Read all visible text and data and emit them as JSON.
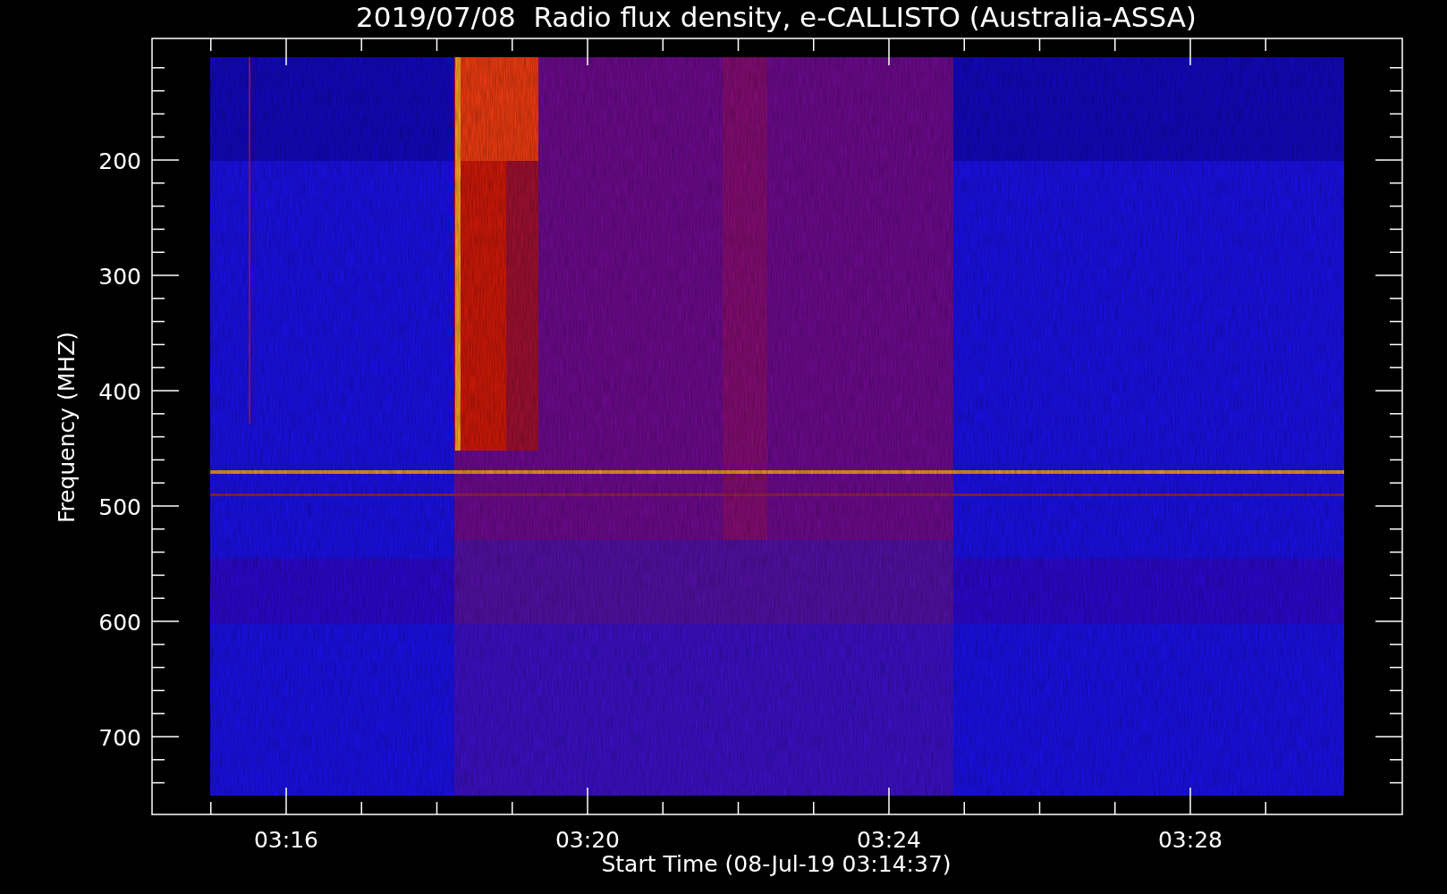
{
  "title": "2019/07/08  Radio flux density, e-CALLISTO (Australia-ASSA)",
  "y_axis": {
    "label": "Frequency (MHZ)",
    "ticks": [
      "200",
      "300",
      "400",
      "500",
      "600",
      "700"
    ]
  },
  "x_axis": {
    "label": "Start Time (08-Jul-19 03:14:37)",
    "ticks": [
      "03:16",
      "03:20",
      "03:24",
      "03:28"
    ]
  }
}
